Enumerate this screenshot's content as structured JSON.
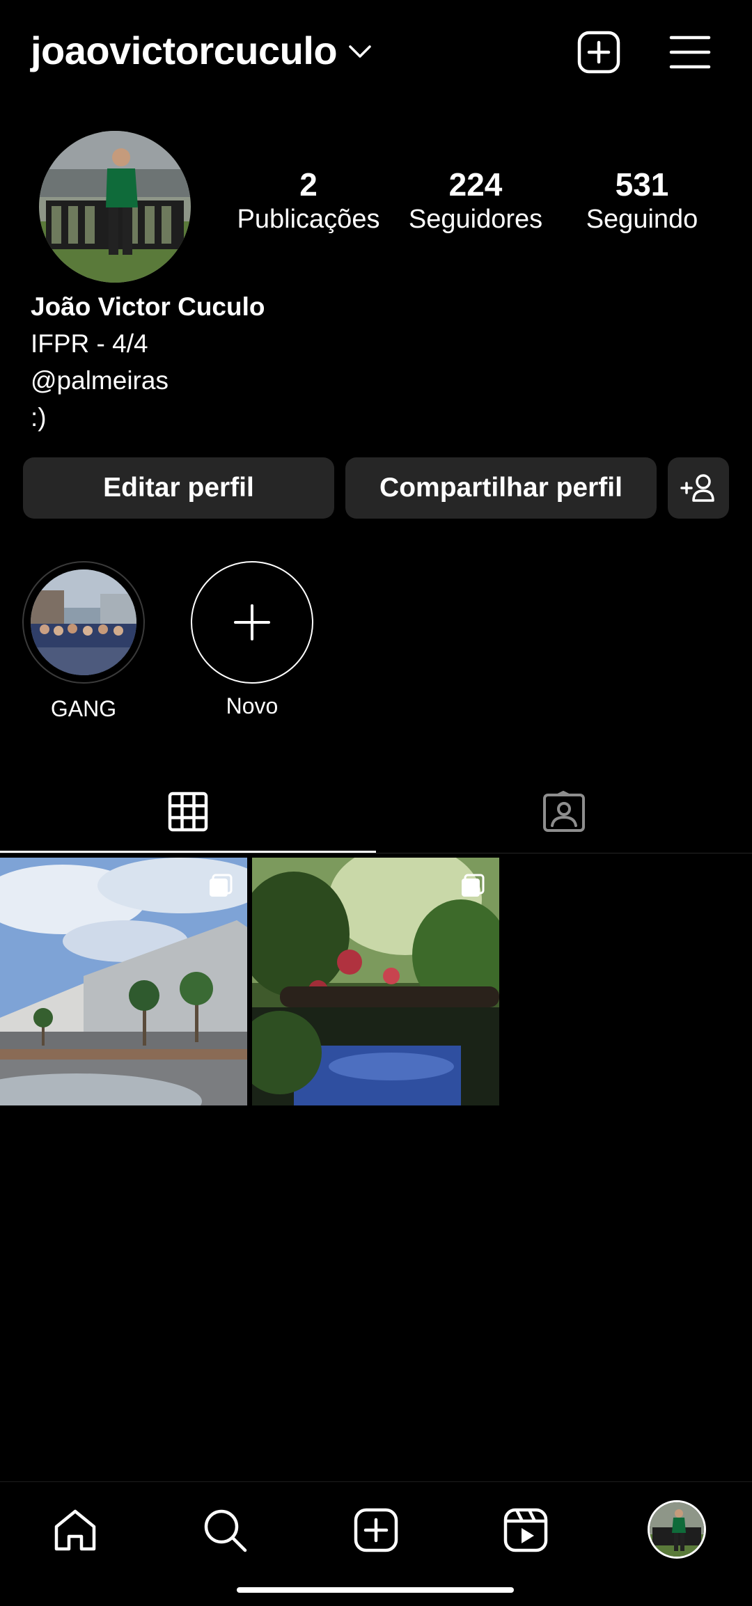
{
  "header": {
    "username": "joaovictorcuculo",
    "icons": [
      "chevron-down-icon",
      "create-plus-icon",
      "menu-icon"
    ]
  },
  "profile": {
    "avatar_icon": "profile-avatar",
    "stats": {
      "posts": {
        "value": "2",
        "label": "Publicações"
      },
      "followers": {
        "value": "224",
        "label": "Seguidores"
      },
      "following": {
        "value": "531",
        "label": "Seguindo"
      }
    },
    "bio": {
      "name": "João Victor Cuculo",
      "lines": [
        "IFPR - 4/4",
        "@palmeiras",
        ":)"
      ]
    }
  },
  "actions": {
    "edit_label": "Editar perfil",
    "share_label": "Compartilhar perfil",
    "add_person_icon": "add-person-icon"
  },
  "highlights": [
    {
      "label": "GANG"
    },
    {
      "label": "Novo"
    }
  ],
  "tabs": [
    {
      "icon": "grid-icon",
      "active": true
    },
    {
      "icon": "tagged-icon",
      "active": false
    }
  ],
  "posts": [
    {
      "type": "carousel",
      "icon": "multiple-posts-icon"
    },
    {
      "type": "carousel",
      "icon": "multiple-posts-icon"
    }
  ],
  "nav": [
    "home-icon",
    "search-icon",
    "create-icon",
    "reels-icon",
    "profile-avatar"
  ],
  "colors": {
    "background": "#000000",
    "button": "#262626",
    "text": "#ffffff"
  }
}
